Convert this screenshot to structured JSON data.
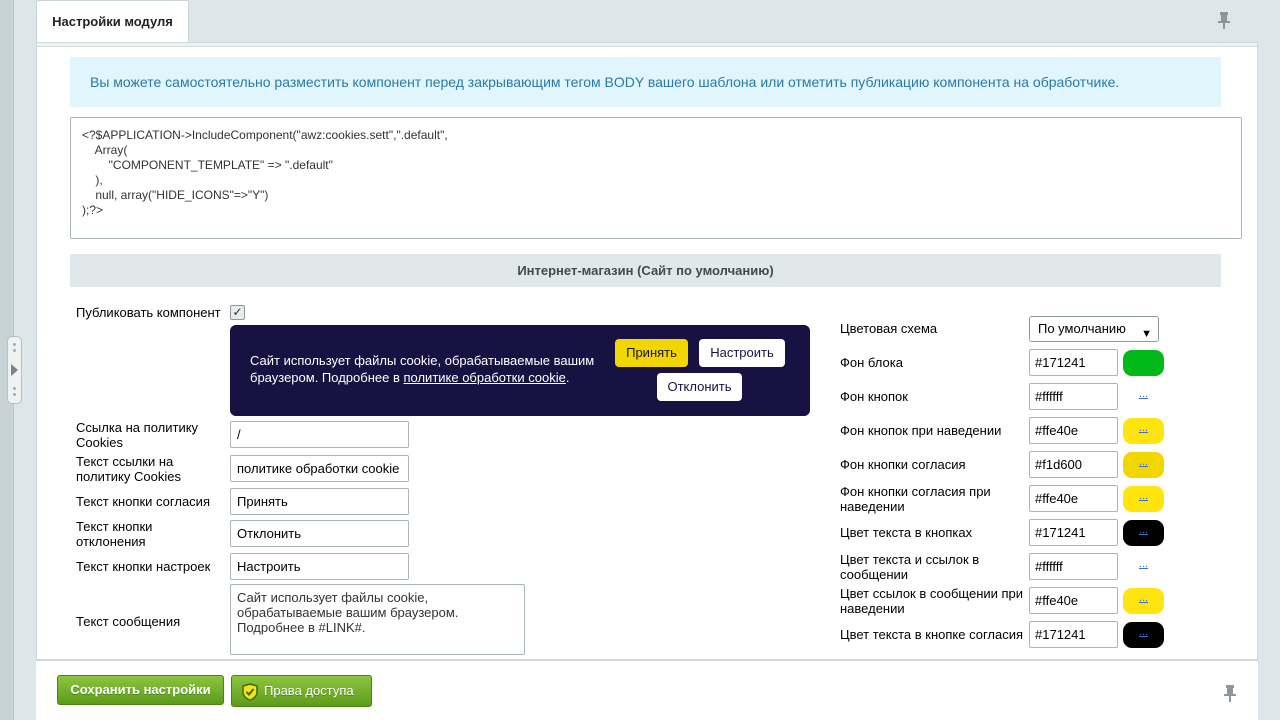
{
  "tab": {
    "label": "Настройки модуля"
  },
  "notice": "Вы можете самостоятельно разместить компонент перед закрывающим тегом BODY вашего шаблона или отметить публикацию компонента на обработчике.",
  "code_lines": [
    "<?$APPLICATION->IncludeComponent(\"awz:cookies.sett\",\".default\",",
    "    Array(",
    "        \"COMPONENT_TEMPLATE\" => \".default\"",
    "    ),",
    "    null, array(\"HIDE_ICONS\"=>\"Y\")",
    ");?>"
  ],
  "section_title": "Интернет-магазин (Сайт по умолчанию)",
  "publish": {
    "label": "Публиковать компонент",
    "checked": true,
    "check_glyph": "✓"
  },
  "preview": {
    "text_before": "Сайт использует файлы cookie, обрабатываемые вашим браузером. Подробнее в ",
    "link_text": "политике обработки cookie",
    "text_after": ".",
    "accept": "Принять",
    "settings": "Настроить",
    "decline": "Отклонить",
    "bg_color": "#171241",
    "accept_color": "#f1d600"
  },
  "left_fields": {
    "policy_link": {
      "label": "Ссылка на политику Cookies",
      "value": "/"
    },
    "policy_text": {
      "label": "Текст ссылки на политику Cookies",
      "value": "политике обработки cookie"
    },
    "accept_text": {
      "label": "Текст кнопки согласия",
      "value": "Принять"
    },
    "decline_text": {
      "label": "Текст кнопки отклонения",
      "value": "Отклонить"
    },
    "settings_text": {
      "label": "Текст кнопки настроек",
      "value": "Настроить"
    },
    "message": {
      "label": "Текст сообщения",
      "value": "Сайт использует файлы cookie, обрабатываемые вашим браузером. Подробнее в  #LINK#."
    }
  },
  "color_scheme": {
    "label": "Цветовая схема",
    "value": "По умолчанию"
  },
  "colors": [
    {
      "label": "Фон блока",
      "value": "#171241",
      "swatch": "#00b81a",
      "swatch_text": ""
    },
    {
      "label": "Фон кнопок",
      "value": "#ffffff",
      "swatch": "#ffffff",
      "swatch_text": "..."
    },
    {
      "label": "Фон кнопок при наведении",
      "value": "#ffe40e",
      "swatch": "#ffe40e",
      "swatch_text": "..."
    },
    {
      "label": "Фон кнопки согласия",
      "value": "#f1d600",
      "swatch": "#f1d600",
      "swatch_text": "..."
    },
    {
      "label": "Фон кнопки согласия при наведении",
      "value": "#ffe40e",
      "swatch": "#ffe40e",
      "swatch_text": "..."
    },
    {
      "label": "Цвет текста в кнопках",
      "value": "#171241",
      "swatch": "#000000",
      "swatch_text": "..."
    },
    {
      "label": "Цвет текста и ссылок в сообщении",
      "value": "#ffffff",
      "swatch": "#ffffff",
      "swatch_text": "..."
    },
    {
      "label": "Цвет ссылок в сообщении при наведении",
      "value": "#ffe40e",
      "swatch": "#ffe40e",
      "swatch_text": "..."
    },
    {
      "label": "Цвет текста в кнопке согласия",
      "value": "#171241",
      "swatch": "#000000",
      "swatch_text": "..."
    }
  ],
  "footer": {
    "save": "Сохранить настройки",
    "access": "Права доступа"
  },
  "icons": {
    "pin": "pin-icon",
    "shield": "shield-check-icon",
    "expand": "expand-arrow-icon"
  }
}
